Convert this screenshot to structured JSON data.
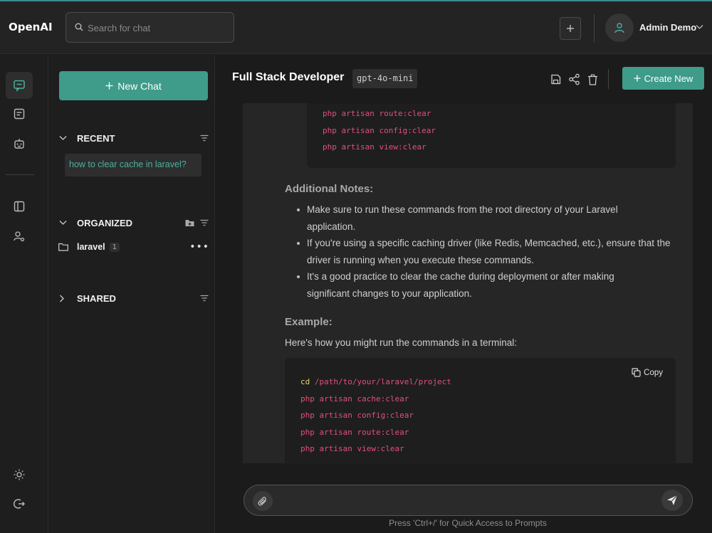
{
  "header": {
    "brand": "OpenAI",
    "search_placeholder": "Search for chat",
    "user_name": "Admin Demo"
  },
  "sidebar": {
    "new_chat_label": "New Chat",
    "recent_label": "RECENT",
    "recent_items": [
      "how to clear cache in laravel?"
    ],
    "organized_label": "ORGANIZED",
    "folders": [
      {
        "name": "laravel",
        "count": "1"
      }
    ],
    "shared_label": "SHARED"
  },
  "main": {
    "title": "Full Stack Developer",
    "model": "gpt-4o-mini",
    "create_new_label": "Create New"
  },
  "message": {
    "top_code": [
      "php artisan route:clear",
      "php artisan config:clear",
      "php artisan view:clear"
    ],
    "notes_heading": "Additional Notes:",
    "notes": [
      "Make sure to run these commands from the root directory of your Laravel application.",
      "If you're using a specific caching driver (like Redis, Memcached, etc.), ensure that the driver is running when you execute these commands.",
      "It's a good practice to clear the cache during deployment or after making significant changes to your application."
    ],
    "example_heading": "Example:",
    "example_intro": "Here's how you might run the commands in a terminal:",
    "copy_label": "Copy",
    "code_cd_keyword": "cd",
    "code_cd_path": "/path/to/your/laravel/project",
    "code_lines": [
      "php artisan cache:clear",
      "php artisan config:clear",
      "php artisan route:clear",
      "php artisan view:clear"
    ]
  },
  "composer": {
    "hint": "Press 'Ctrl+/' for Quick Access to Prompts"
  },
  "colors": {
    "accent": "#3f9b8a",
    "code_pink": "#e2507a",
    "code_yellow": "#e8d26a"
  }
}
